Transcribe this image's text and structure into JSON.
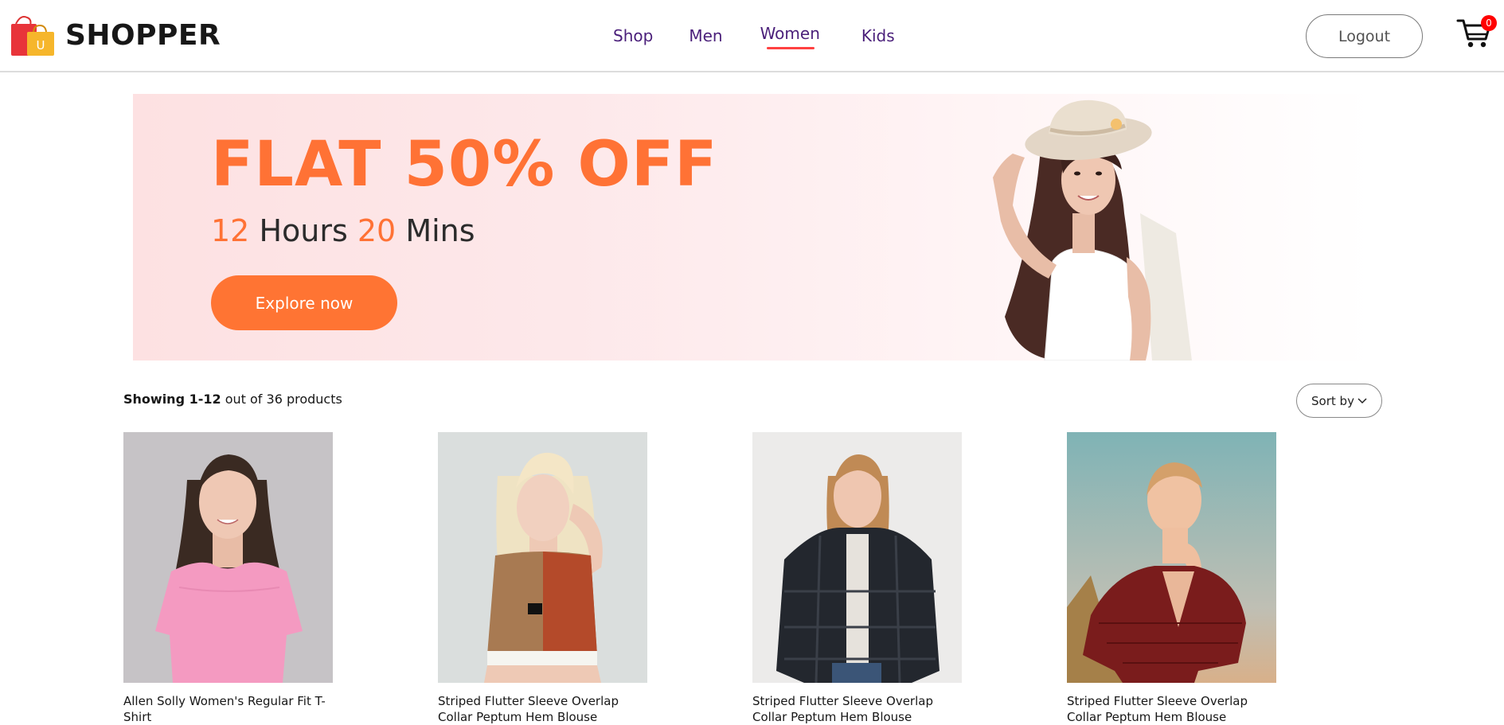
{
  "brand": {
    "name": "SHOPPER"
  },
  "nav": {
    "items": [
      {
        "label": "Shop"
      },
      {
        "label": "Men"
      },
      {
        "label": "Women",
        "active": true
      },
      {
        "label": "Kids"
      }
    ]
  },
  "header": {
    "logout_label": "Logout",
    "cart_count": "0"
  },
  "banner": {
    "headline": "FLAT 50% OFF",
    "hours_value": "12",
    "hours_label": "Hours",
    "mins_value": "20",
    "mins_label": "Mins",
    "cta_label": "Explore now"
  },
  "listing": {
    "showing_bold": "Showing 1-12",
    "showing_rest": " out of 36 products",
    "sort_label": "Sort by"
  },
  "products": [
    {
      "name": "Allen Solly Women's Regular Fit T-Shirt"
    },
    {
      "name": "Striped Flutter Sleeve Overlap Collar Peptum Hem Blouse"
    },
    {
      "name": "Striped Flutter Sleeve Overlap Collar Peptum Hem Blouse"
    },
    {
      "name": "Striped Flutter Sleeve Overlap Collar Peptum Hem Blouse"
    }
  ],
  "colors": {
    "accent": "#ff7235",
    "nav_text": "#4a1f7a",
    "active_underline": "#ff4141",
    "cart_badge": "#ff0000"
  }
}
